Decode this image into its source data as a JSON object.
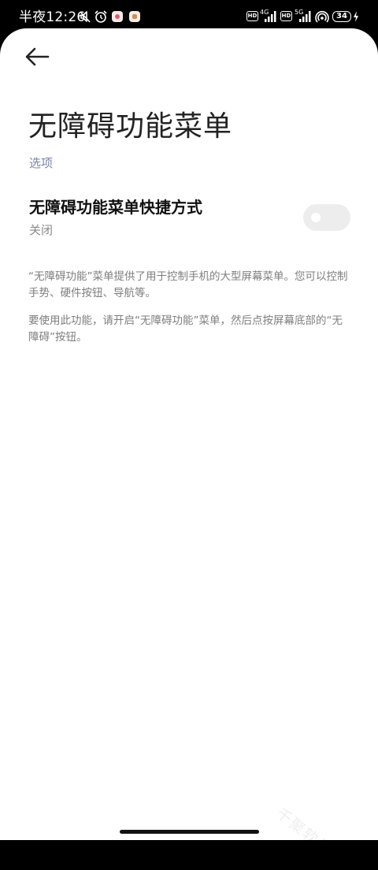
{
  "status_bar": {
    "time": "半夜12:26",
    "hd_label": "HD",
    "network_1": "4G",
    "network_2": "5G",
    "battery": "34",
    "icons": [
      "mute-icon",
      "alarm-icon",
      "app-notification-icon",
      "app-notification-icon",
      "signal-icon",
      "signal-icon",
      "hotspot-icon",
      "battery-icon",
      "charging-icon"
    ]
  },
  "header": {
    "back_icon": "arrow-left-icon",
    "title": "无障碍功能菜单"
  },
  "section": {
    "label": "选项"
  },
  "setting": {
    "title": "无障碍功能菜单快捷方式",
    "status": "关闭",
    "enabled": false
  },
  "description": {
    "paragraph_1": "“无障碍功能”菜单提供了用于控制手机的大型屏幕菜单。您可以控制手势、硬件按钮、导航等。",
    "paragraph_2": "要使用此功能，请开启“无障碍功能”菜单，然后点按屏幕底部的“无障碍”按钮。"
  },
  "watermark": "千聚软件站",
  "colors": {
    "section_label": "#7a86a6",
    "toggle_off": "#ededed",
    "text_secondary": "#7e7e7e"
  }
}
